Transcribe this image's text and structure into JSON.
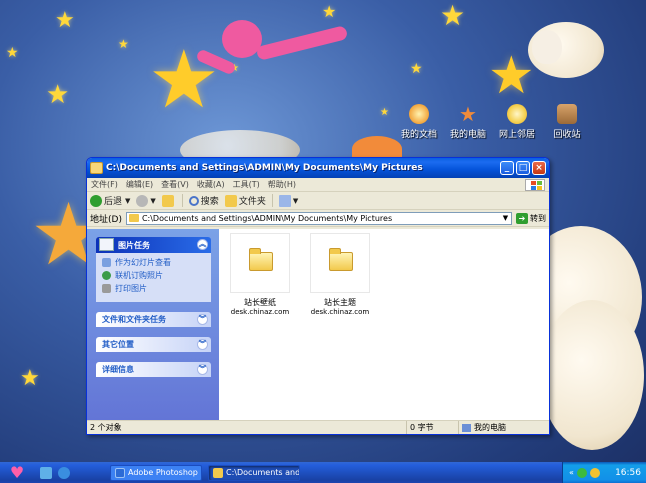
{
  "desktop": {
    "icons": [
      {
        "label": "我的文档",
        "name": "my-documents"
      },
      {
        "label": "我的电脑",
        "name": "my-computer"
      },
      {
        "label": "网上邻居",
        "name": "network-places"
      },
      {
        "label": "回收站",
        "name": "recycle-bin"
      }
    ]
  },
  "window": {
    "title": "C:\\Documents and Settings\\ADMIN\\My Documents\\My Pictures",
    "menu": [
      "文件(F)",
      "编辑(E)",
      "查看(V)",
      "收藏(A)",
      "工具(T)",
      "帮助(H)"
    ],
    "toolbar": {
      "back": "后退",
      "search": "搜索",
      "folders": "文件夹"
    },
    "address": {
      "label": "地址(D)",
      "value": "C:\\Documents and Settings\\ADMIN\\My Documents\\My Pictures",
      "go": "转到"
    },
    "taskpane": {
      "picture_tasks": {
        "title": "图片任务",
        "links": [
          "作为幻灯片查看",
          "联机订购照片",
          "打印图片"
        ]
      },
      "file_folder_tasks": "文件和文件夹任务",
      "other_places": "其它位置",
      "details": "详细信息"
    },
    "files": [
      {
        "name": "站长壁纸",
        "sub": "desk.chinaz.com"
      },
      {
        "name": "站长主题",
        "sub": "desk.chinaz.com"
      }
    ],
    "status": {
      "objects": "2 个对象",
      "size": "0 字节",
      "location": "我的电脑"
    }
  },
  "taskbar": {
    "tasks": [
      "Adobe Photoshop ...",
      "C:\\Documents and..."
    ],
    "clock": "16:56"
  }
}
